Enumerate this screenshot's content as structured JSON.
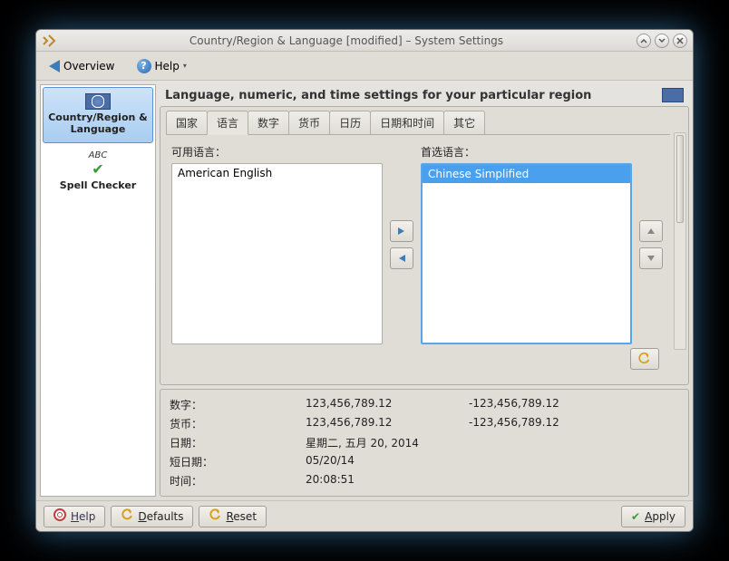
{
  "window": {
    "title": "Country/Region & Language [modified] – System Settings"
  },
  "toolbar": {
    "overview": "Overview",
    "help": "Help"
  },
  "sidebar": {
    "items": [
      {
        "label": "Country/Region & Language"
      },
      {
        "label": "Spell Checker"
      }
    ]
  },
  "header": {
    "title": "Language, numeric, and time settings for your particular region"
  },
  "tabs": [
    "国家",
    "语言",
    "数字",
    "货币",
    "日历",
    "日期和时间",
    "其它"
  ],
  "active_tab": 1,
  "lang": {
    "available_label": "可用语言：",
    "preferred_label": "首选语言：",
    "available": [
      "American English"
    ],
    "preferred": [
      "Chinese Simplified"
    ]
  },
  "preview": {
    "rows": [
      {
        "label": "数字：",
        "v1": "123,456,789.12",
        "v2": "-123,456,789.12"
      },
      {
        "label": "货币：",
        "v1": " 123,456,789.12",
        "v2": "-123,456,789.12"
      },
      {
        "label": "日期：",
        "v1": "星期二, 五月 20, 2014",
        "v2": ""
      },
      {
        "label": "短日期：",
        "v1": "05/20/14",
        "v2": ""
      },
      {
        "label": "时间：",
        "v1": "20:08:51",
        "v2": ""
      }
    ]
  },
  "footer": {
    "help": "Help",
    "defaults": "Defaults",
    "reset": "Reset",
    "apply": "Apply"
  }
}
